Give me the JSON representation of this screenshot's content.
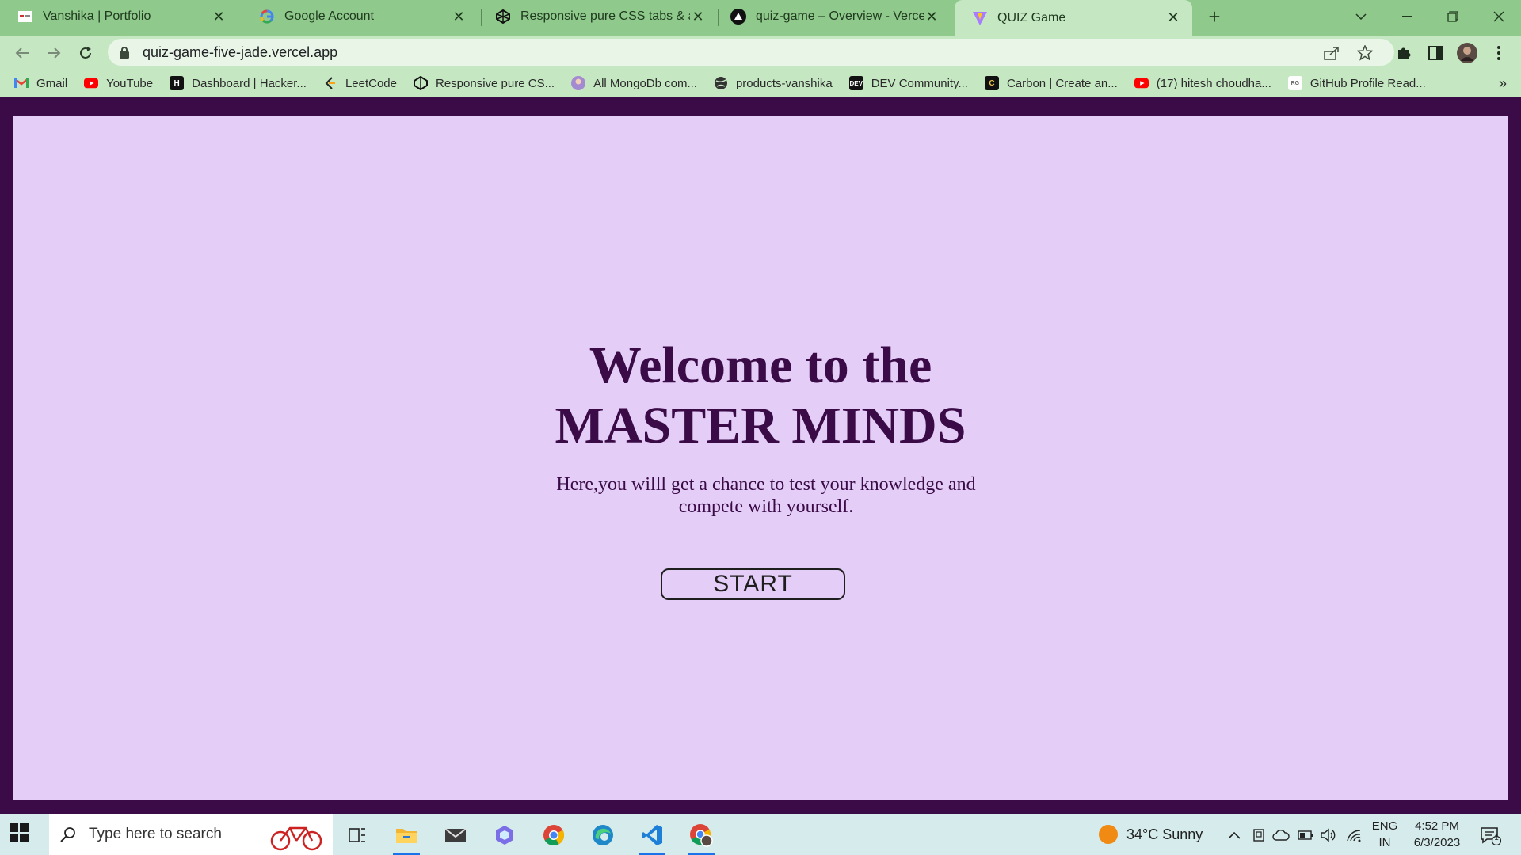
{
  "browser": {
    "tabs": [
      {
        "title": "Vanshika | Portfolio",
        "icon": "portfolio-favicon"
      },
      {
        "title": "Google Account",
        "icon": "google-g-favicon"
      },
      {
        "title": "Responsive pure CSS tabs & acc",
        "icon": "codepen-favicon"
      },
      {
        "title": "quiz-game – Overview - Vercel",
        "icon": "vercel-favicon"
      },
      {
        "title": "QUIZ Game",
        "icon": "vite-favicon",
        "active": true
      }
    ],
    "url": "quiz-game-five-jade.vercel.app",
    "bookmarks": [
      {
        "label": "Gmail",
        "icon": "gmail-icon"
      },
      {
        "label": "YouTube",
        "icon": "youtube-icon"
      },
      {
        "label": "Dashboard | Hacker...",
        "icon": "hackerrank-icon"
      },
      {
        "label": "LeetCode",
        "icon": "leetcode-icon"
      },
      {
        "label": "Responsive pure CS...",
        "icon": "codepen-icon"
      },
      {
        "label": "All MongoDb com...",
        "icon": "avatar-icon"
      },
      {
        "label": "products-vanshika",
        "icon": "globe-icon"
      },
      {
        "label": "DEV Community...",
        "icon": "dev-icon"
      },
      {
        "label": "Carbon | Create an...",
        "icon": "carbon-icon"
      },
      {
        "label": "(17) hitesh choudha...",
        "icon": "youtube-icon"
      },
      {
        "label": "GitHub Profile Read...",
        "icon": "github-readme-icon"
      }
    ]
  },
  "page": {
    "heading_line1": "Welcome to the",
    "heading_line2": "MASTER MINDS",
    "subtitle": "Here,you willl get a chance to test your knowledge and compete with yourself.",
    "start_label": "START",
    "background_color": "#e4cdf6",
    "text_color": "#3a0b47"
  },
  "taskbar": {
    "search_placeholder": "Type here to search",
    "weather": "34°C  Sunny",
    "lang_line1": "ENG",
    "lang_line2": "IN",
    "time": "4:52 PM",
    "date": "6/3/2023",
    "notification_count": "1"
  }
}
